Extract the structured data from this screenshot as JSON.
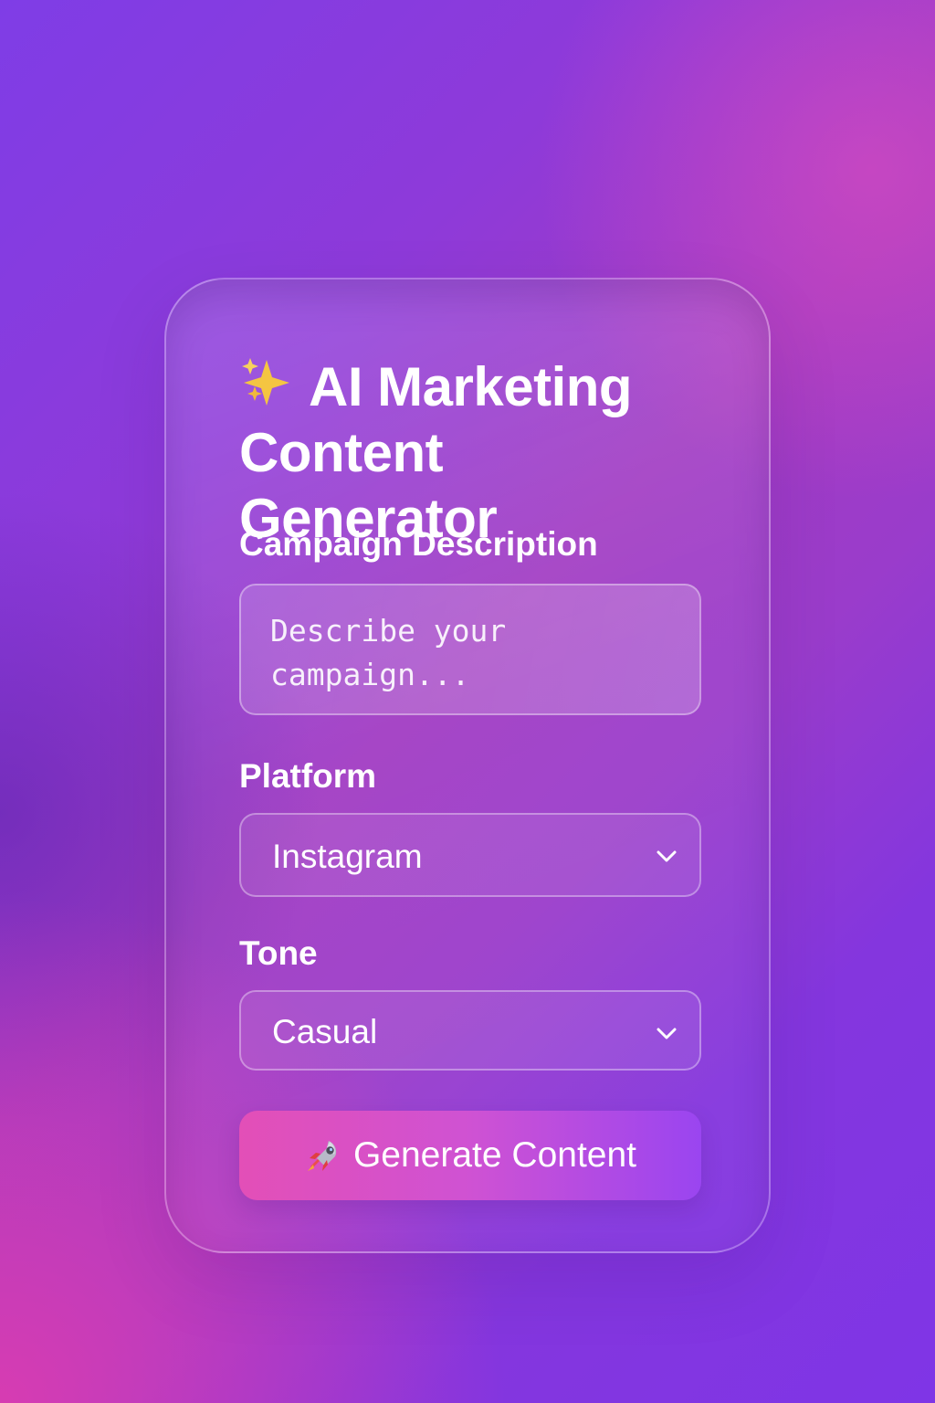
{
  "app": {
    "title": "AI Marketing Content Generator"
  },
  "form": {
    "campaign_label": "Campaign Description",
    "campaign_placeholder": "Describe your campaign...",
    "platform_label": "Platform",
    "platform_value": "Instagram",
    "tone_label": "Tone",
    "tone_value": "Casual",
    "generate_label": "Generate Content"
  },
  "icons": {
    "title_icon": "sparkles-icon",
    "button_icon": "rocket-icon",
    "select_icon": "chevron-down-icon"
  },
  "colors": {
    "background_start": "#7f3de6",
    "background_middle": "#a13bc3",
    "background_end": "#7f35e6",
    "button_start": "#e34fb7",
    "button_end": "#9a45f0",
    "sparkle": "#f4c542"
  }
}
